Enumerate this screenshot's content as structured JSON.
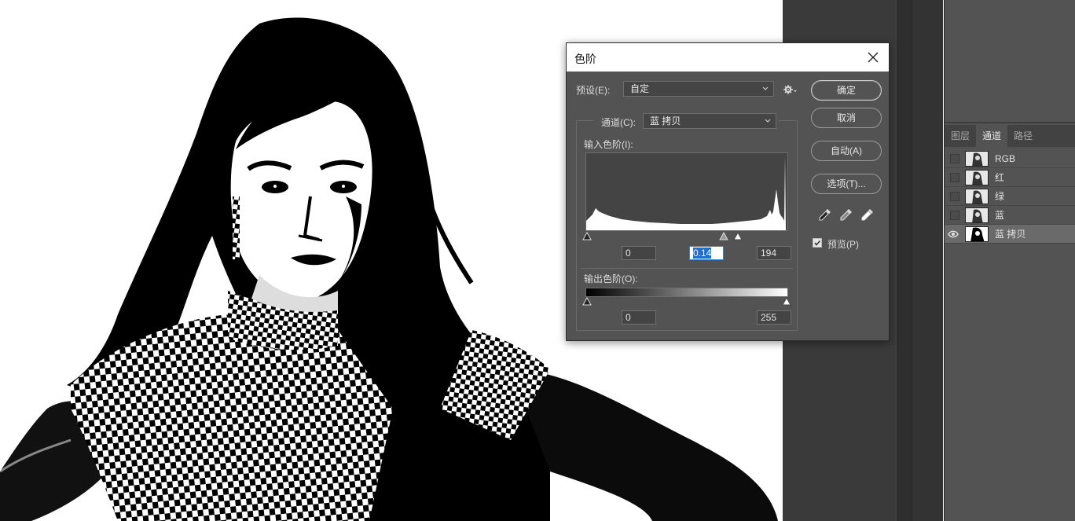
{
  "dialog": {
    "title": "色阶",
    "preset_label": "预设(E):",
    "preset_value": "自定",
    "channel_label": "通道(C):",
    "channel_value": "蓝 拷贝",
    "input_levels_label": "输入色阶(I):",
    "input_black": "0",
    "input_gamma": "0.14",
    "input_white": "194",
    "output_levels_label": "输出色阶(O):",
    "output_black": "0",
    "output_white": "255",
    "buttons": {
      "ok": "确定",
      "cancel": "取消",
      "auto": "自动(A)",
      "options": "选项(T)..."
    },
    "preview_label": "预览(P)",
    "preview_checked": true
  },
  "channels_panel": {
    "tabs": [
      "图层",
      "通道",
      "路径"
    ],
    "active_tab": "通道",
    "channels": [
      {
        "name": "RGB",
        "visible": false,
        "selected": false
      },
      {
        "name": "红",
        "visible": false,
        "selected": false
      },
      {
        "name": "绿",
        "visible": false,
        "selected": false
      },
      {
        "name": "蓝",
        "visible": false,
        "selected": false
      },
      {
        "name": "蓝 拷贝",
        "visible": true,
        "selected": true
      }
    ]
  },
  "icons": [
    "close-icon",
    "gear-icon",
    "chevron-down-icon",
    "black-eyedropper-icon",
    "gray-eyedropper-icon",
    "white-eyedropper-icon",
    "eye-icon",
    "checkbox-checked-icon"
  ],
  "colors": {
    "dialog_bg": "#535353",
    "panel_bg": "#535353",
    "selection": "#1e6fd0"
  }
}
